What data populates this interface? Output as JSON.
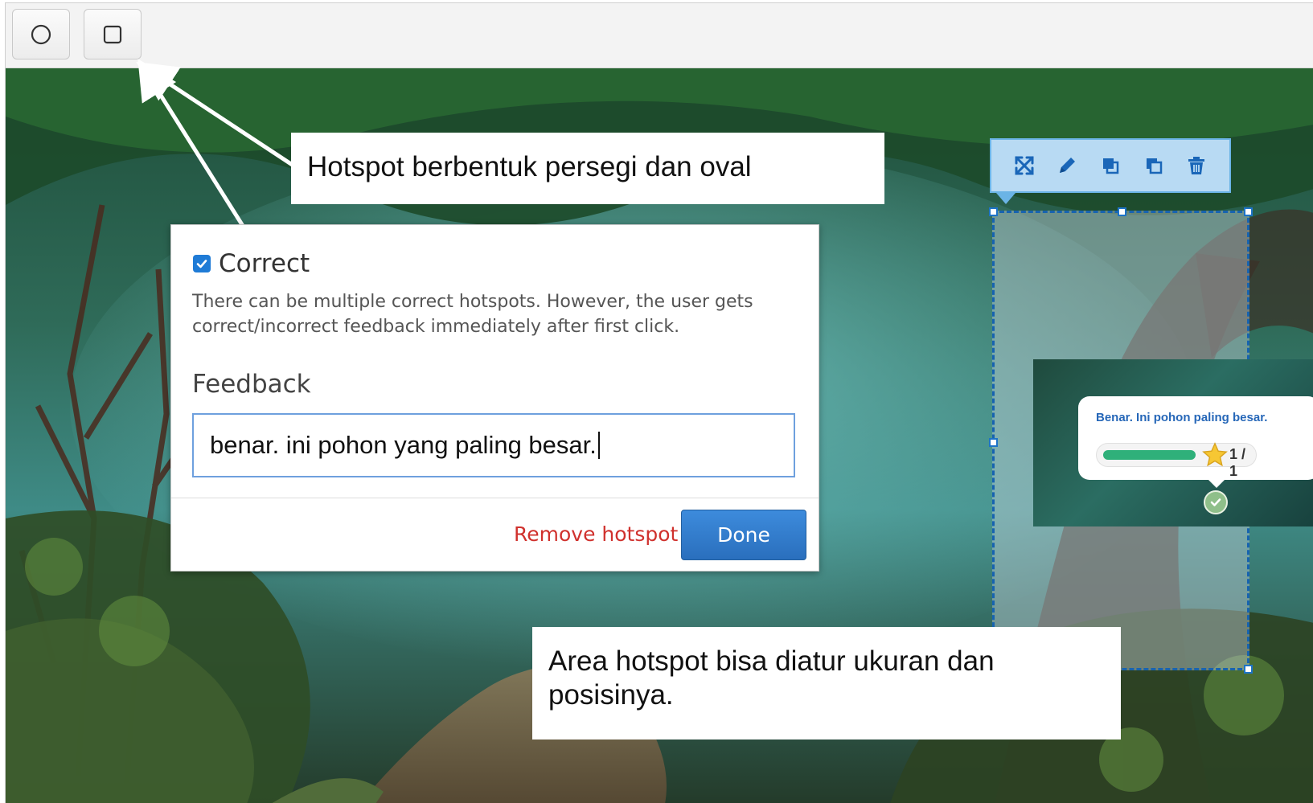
{
  "toolbar": {
    "tools": [
      {
        "name": "oval-tool",
        "icon": "circle-icon"
      },
      {
        "name": "rectangle-tool",
        "icon": "square-icon"
      }
    ]
  },
  "callouts": {
    "top": "Hotspot berbentuk persegi dan oval",
    "bottom": "Area hotspot bisa diatur ukuran dan posisinya."
  },
  "dialog": {
    "correct_label": "Correct",
    "correct_checked": true,
    "help_text": "There can be multiple correct hotspots. However, the user gets correct/incorrect feedback immediately after first click.",
    "feedback_label": "Feedback",
    "feedback_value": "benar. ini pohon yang paling besar.",
    "remove_label": "Remove hotspot",
    "done_label": "Done"
  },
  "hotspot_toolbar": {
    "icons": [
      "expand-icon",
      "pencil-icon",
      "bring-front-icon",
      "send-back-icon",
      "trash-icon"
    ]
  },
  "preview": {
    "feedback_text": "Benar. Ini pohon paling besar.",
    "progress": 0.72,
    "score": "1 / 1"
  },
  "colors": {
    "accent": "#1f7bd6",
    "done_button": "#2f7ac8",
    "remove_link": "#d0312d",
    "hotspot_border": "#1763b0",
    "progress_fill": "#2fb07a",
    "preview_text": "#2667b8"
  }
}
